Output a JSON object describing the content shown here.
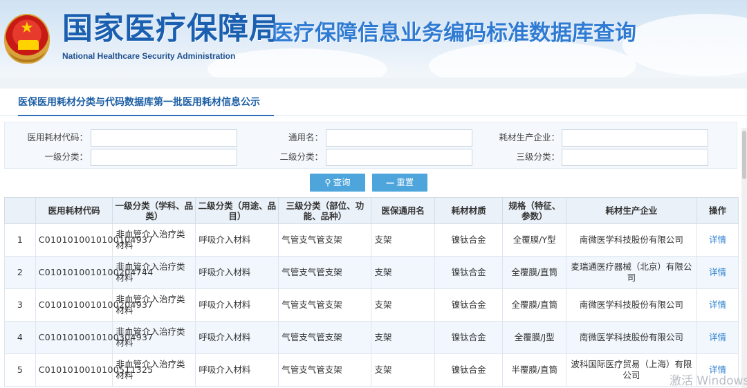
{
  "header": {
    "agency_cn": "国家医疗保障局",
    "agency_en": "National Healthcare Security Administration",
    "site_title": "医疗保障信息业务编码标准数据库查询"
  },
  "tab": {
    "label": "医保医用耗材分类与代码数据库第一批医用耗材信息公示"
  },
  "search": {
    "fields": [
      {
        "label": "医用耗材代码：",
        "value": ""
      },
      {
        "label": "通用名：",
        "value": ""
      },
      {
        "label": "耗材生产企业：",
        "value": ""
      },
      {
        "label": "一级分类：",
        "value": ""
      },
      {
        "label": "二级分类：",
        "value": ""
      },
      {
        "label": "三级分类：",
        "value": ""
      }
    ],
    "query_label": "查询",
    "reset_label": "重置"
  },
  "table": {
    "headers": [
      "",
      "医用耗材代码",
      "一级分类（学科、品类）",
      "二级分类（用途、品目）",
      "三级分类（部位、功能、品种）",
      "医保通用名",
      "耗材材质",
      "规格（特征、参数）",
      "耗材生产企业",
      "操作"
    ],
    "rows": [
      {
        "no": "1",
        "code": "C0101010010100104937",
        "cat1": "非血管介入治疗类材料",
        "cat2": "呼吸介入材料",
        "cat3": "气管支气管支架",
        "name": "支架",
        "material": "镍钛合金",
        "spec": "全覆膜/Y型",
        "maker": "南微医学科技股份有限公司",
        "action": "详情"
      },
      {
        "no": "2",
        "code": "C0101010010100204744",
        "cat1": "非血管介入治疗类材料",
        "cat2": "呼吸介入材料",
        "cat3": "气管支气管支架",
        "name": "支架",
        "material": "镍钛合金",
        "spec": "全覆膜/直筒",
        "maker": "麦瑞通医疗器械（北京）有限公司",
        "action": "详情"
      },
      {
        "no": "3",
        "code": "C0101010010100204937",
        "cat1": "非血管介入治疗类材料",
        "cat2": "呼吸介入材料",
        "cat3": "气管支气管支架",
        "name": "支架",
        "material": "镍钛合金",
        "spec": "全覆膜/直筒",
        "maker": "南微医学科技股份有限公司",
        "action": "详情"
      },
      {
        "no": "4",
        "code": "C0101010010100304937",
        "cat1": "非血管介入治疗类材料",
        "cat2": "呼吸介入材料",
        "cat3": "气管支气管支架",
        "name": "支架",
        "material": "镍钛合金",
        "spec": "全覆膜/J型",
        "maker": "南微医学科技股份有限公司",
        "action": "详情"
      },
      {
        "no": "5",
        "code": "C0101010010100511325",
        "cat1": "非血管介入治疗类材料",
        "cat2": "呼吸介入材料",
        "cat3": "气管支气管支架",
        "name": "支架",
        "material": "镍钛合金",
        "spec": "半覆膜/直筒",
        "maker": "波科国际医疗贸易（上海）有限公司",
        "action": "详情"
      }
    ]
  },
  "watermark": "激活 Windows",
  "colors": {
    "brand": "#1a5fb0",
    "title": "#2f7bd3",
    "button": "#4ea5dc",
    "link": "#2a7fd0",
    "header_bg": "#eaf1f8",
    "row_alt": "#f1f7fd"
  }
}
